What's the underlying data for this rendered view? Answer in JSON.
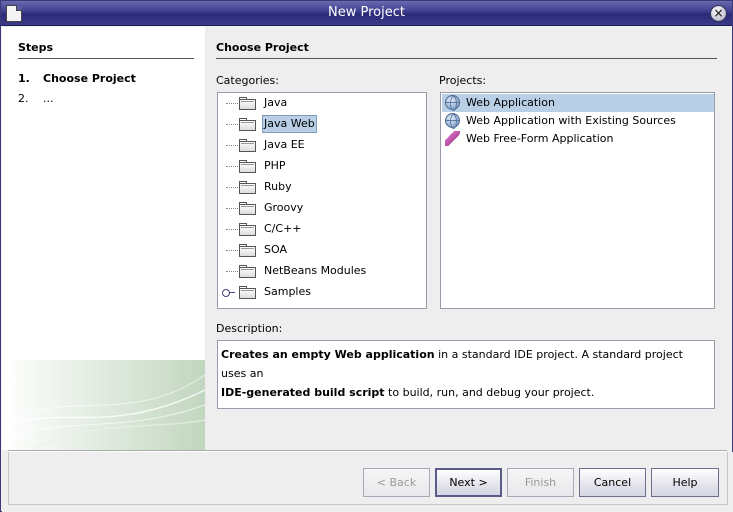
{
  "window": {
    "title": "New Project"
  },
  "steps": {
    "title": "Steps",
    "items": [
      {
        "num": "1.",
        "label": "Choose Project"
      },
      {
        "num": "2.",
        "label": "..."
      }
    ]
  },
  "main": {
    "title": "Choose Project"
  },
  "categories": {
    "label": "Categories:",
    "items": [
      "Java",
      "Java Web",
      "Java EE",
      "PHP",
      "Ruby",
      "Groovy",
      "C/C++",
      "SOA",
      "NetBeans Modules",
      "Samples"
    ],
    "selected": "Java Web"
  },
  "projects": {
    "label": "Projects:",
    "items": [
      {
        "label": "Web Application",
        "icon": "globe-icon"
      },
      {
        "label": "Web Application with Existing Sources",
        "icon": "globe-icon"
      },
      {
        "label": "Web Free-Form Application",
        "icon": "freeform-icon"
      }
    ],
    "selected": "Web Application"
  },
  "description": {
    "label": "Description:",
    "bold1": "Creates an empty Web application",
    "text1": " in a standard IDE project. A standard project uses an",
    "bold2": "IDE-generated build script",
    "text2": " to build, run, and debug your project."
  },
  "buttons": {
    "back": "< Back",
    "next": "Next >",
    "finish": "Finish",
    "cancel": "Cancel",
    "help": "Help"
  }
}
